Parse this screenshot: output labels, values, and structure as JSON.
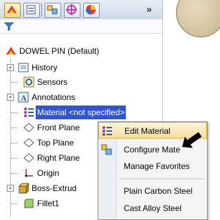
{
  "toolbar": {
    "tabs": [
      {
        "icon": "feature-manager-icon"
      },
      {
        "icon": "property-manager-icon"
      },
      {
        "icon": "configuration-manager-icon"
      },
      {
        "icon": "dimxpert-icon"
      },
      {
        "icon": "display-manager-icon"
      }
    ],
    "more_label": "»"
  },
  "filter": {
    "icon": "filter-icon"
  },
  "tree": {
    "root": "DOWEL PIN  (Default)",
    "items": [
      {
        "label": "History",
        "icon": "history-icon",
        "expandable": true
      },
      {
        "label": "Sensors",
        "icon": "sensors-icon",
        "expandable": false
      },
      {
        "label": "Annotations",
        "icon": "annotations-icon",
        "expandable": true
      },
      {
        "label": "Material <not specified>",
        "icon": "material-icon",
        "expandable": false,
        "selected": true
      },
      {
        "label": "Front Plane",
        "icon": "plane-icon",
        "expandable": false
      },
      {
        "label": "Top Plane",
        "icon": "plane-icon",
        "expandable": false
      },
      {
        "label": "Right Plane",
        "icon": "plane-icon",
        "expandable": false
      },
      {
        "label": "Origin",
        "icon": "origin-icon",
        "expandable": false
      },
      {
        "label": "Boss-Extrud",
        "icon": "boss-extrude-icon",
        "expandable": true
      },
      {
        "label": "Fillet1",
        "icon": "fillet-icon",
        "expandable": false
      }
    ]
  },
  "context_menu": {
    "items": [
      {
        "label": "Edit Material",
        "icon": "edit-material-icon",
        "highlighted": true
      },
      {
        "label": "Configure Mate",
        "icon": "configure-material-icon"
      },
      {
        "label": "Manage Favorites",
        "icon": ""
      },
      {
        "label": "Plain Carbon Steel",
        "icon": ""
      },
      {
        "label": "Cast Alloy Steel",
        "icon": ""
      }
    ]
  },
  "colors": {
    "selection": "#3355cc",
    "menu_highlight": "#f6dfa0"
  }
}
